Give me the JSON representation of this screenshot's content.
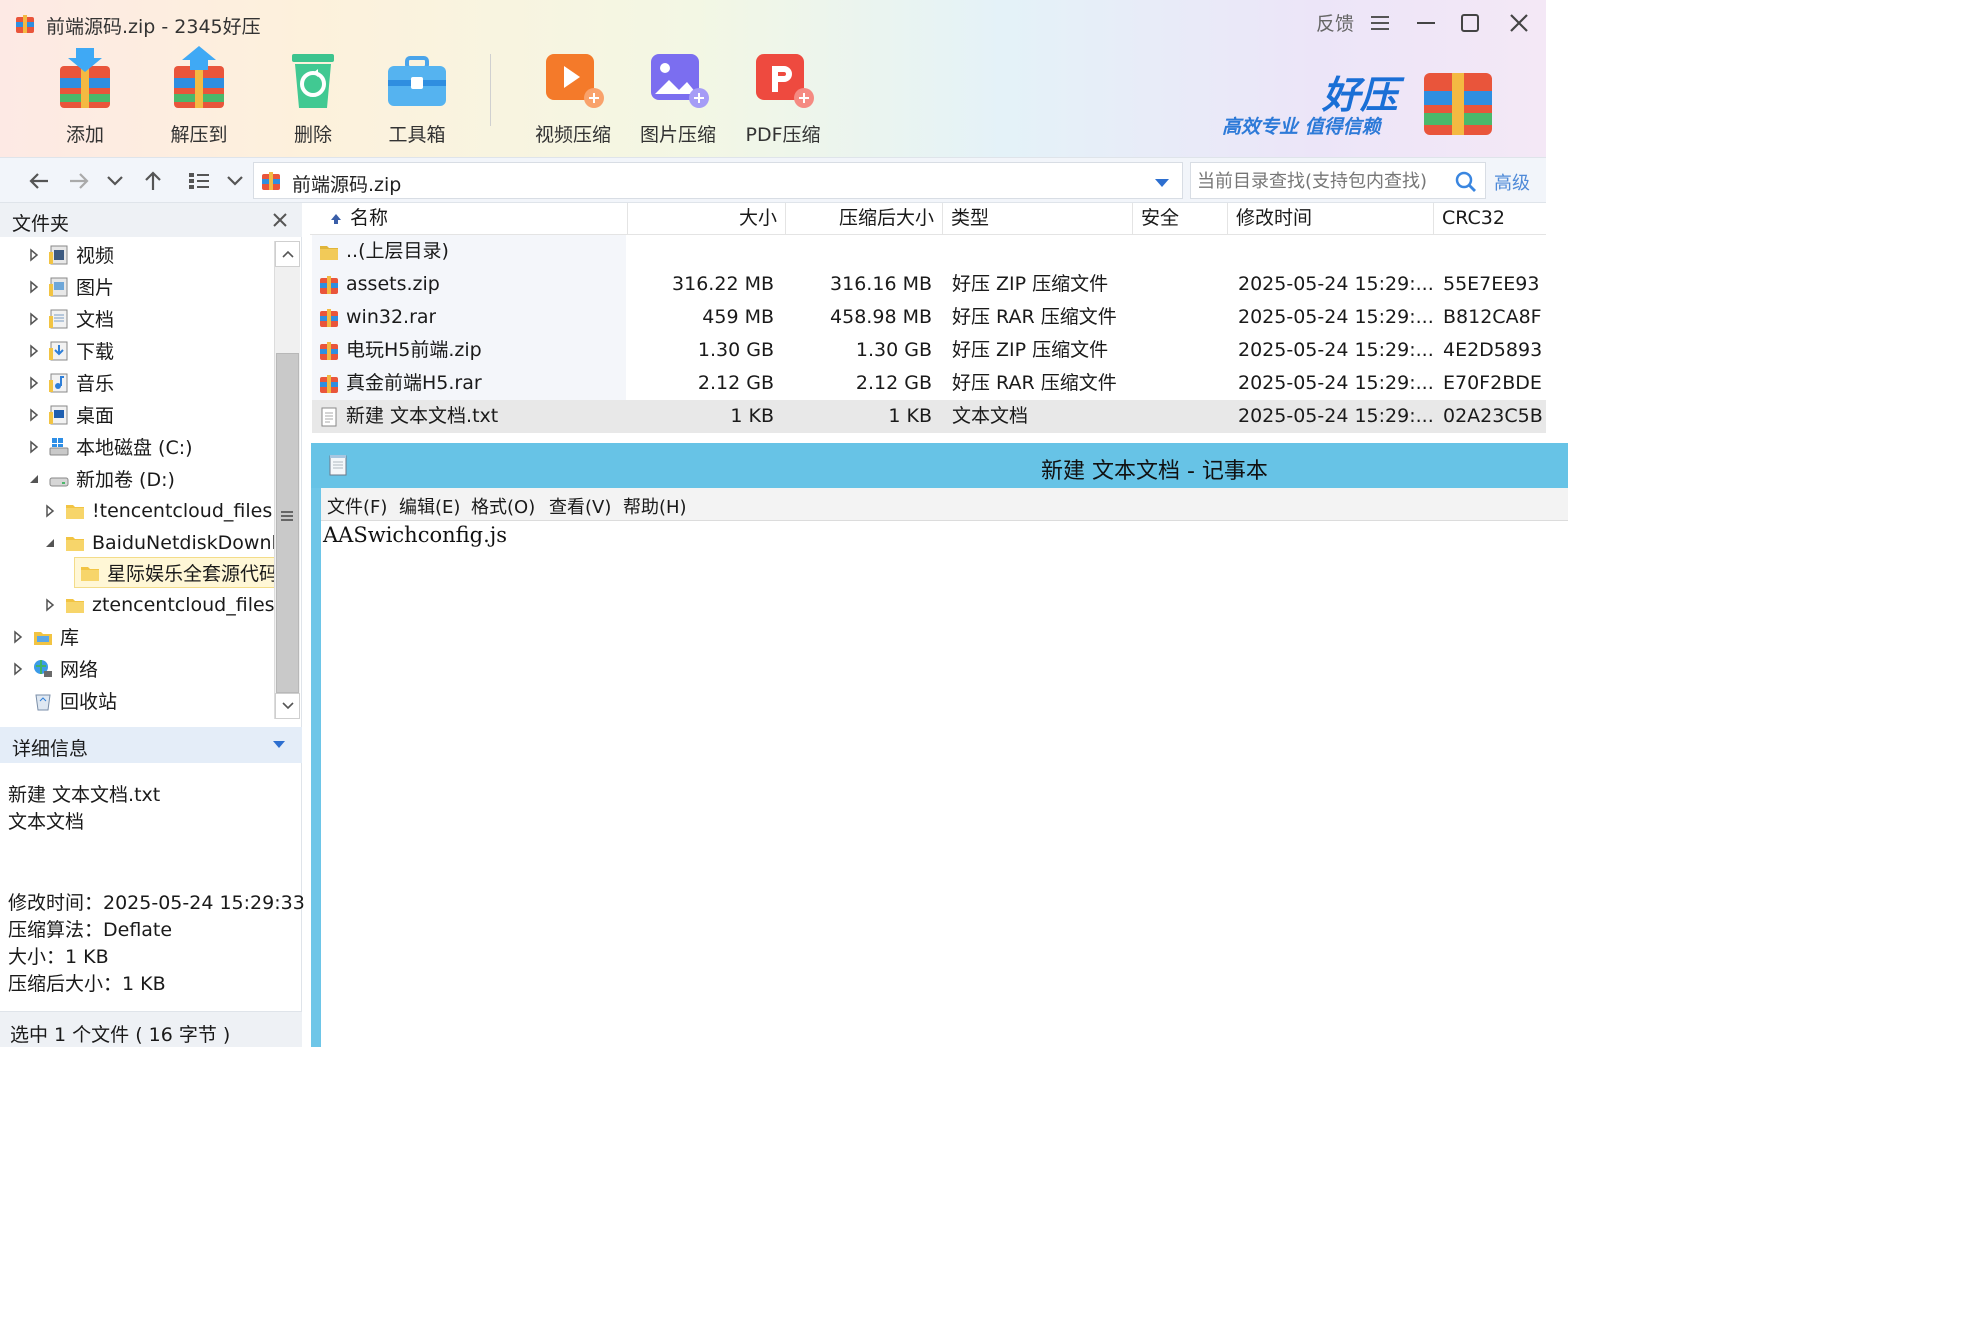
{
  "window": {
    "title": "前端源码.zip - 2345好压",
    "feedback": "反馈"
  },
  "toolbar": {
    "add": "添加",
    "extract": "解压到",
    "delete": "删除",
    "toolbox": "工具箱",
    "video": "视频压缩",
    "image": "图片压缩",
    "pdf": "PDF压缩"
  },
  "brand": {
    "name": "好压",
    "slogan": "高效专业 值得信赖"
  },
  "nav": {
    "address": "前端源码.zip",
    "search_placeholder": "当前目录查找(支持包内查找)",
    "advanced": "高级"
  },
  "sidebar": {
    "title": "文件夹",
    "tree": [
      {
        "label": "视频"
      },
      {
        "label": "图片"
      },
      {
        "label": "文档"
      },
      {
        "label": "下载"
      },
      {
        "label": "音乐"
      },
      {
        "label": "桌面"
      },
      {
        "label": "本地磁盘 (C:)"
      },
      {
        "label": "新加卷 (D:)"
      },
      {
        "label": "!tencentcloud_files"
      },
      {
        "label": "BaiduNetdiskDownload"
      },
      {
        "label": "星际娱乐全套源代码"
      },
      {
        "label": "ztencentcloud_files"
      },
      {
        "label": "库"
      },
      {
        "label": "网络"
      },
      {
        "label": "回收站"
      }
    ],
    "details_title": "详细信息",
    "details": {
      "filename": "新建 文本文档.txt",
      "filetype": "文本文档",
      "modified": "修改时间：2025-05-24 15:29:33",
      "method": "压缩算法：Deflate",
      "size": "大小：1 KB",
      "packed": "压缩后大小：1 KB"
    },
    "status": "选中 1 个文件 ( 16 字节 )"
  },
  "filelist": {
    "headers": {
      "name": "名称",
      "size": "大小",
      "packed": "压缩后大小",
      "type": "类型",
      "security": "安全",
      "modified": "修改时间",
      "crc": "CRC32"
    },
    "rows": [
      {
        "name": "..(上层目录)",
        "size": "",
        "packed": "",
        "type": "",
        "modified": "",
        "crc": ""
      },
      {
        "name": "assets.zip",
        "size": "316.22 MB",
        "packed": "316.16 MB",
        "type": "好压 ZIP 压缩文件",
        "modified": "2025-05-24 15:29:...",
        "crc": "55E7EE93"
      },
      {
        "name": "win32.rar",
        "size": "459 MB",
        "packed": "458.98 MB",
        "type": "好压 RAR 压缩文件",
        "modified": "2025-05-24 15:29:...",
        "crc": "B812CA8F"
      },
      {
        "name": "电玩H5前端.zip",
        "size": "1.30 GB",
        "packed": "1.30 GB",
        "type": "好压 ZIP 压缩文件",
        "modified": "2025-05-24 15:29:...",
        "crc": "4E2D5893"
      },
      {
        "name": "真金前端H5.rar",
        "size": "2.12 GB",
        "packed": "2.12 GB",
        "type": "好压 RAR 压缩文件",
        "modified": "2025-05-24 15:29:...",
        "crc": "E70F2BDE"
      },
      {
        "name": "新建 文本文档.txt",
        "size": "1 KB",
        "packed": "1 KB",
        "type": "文本文档",
        "modified": "2025-05-24 15:29:...",
        "crc": "02A23C5B"
      }
    ]
  },
  "notepad": {
    "title": "新建 文本文档 - 记事本",
    "menu": [
      "文件(F)",
      "编辑(E)",
      "格式(O)",
      "查看(V)",
      "帮助(H)"
    ],
    "content": "AASwichconfig.js"
  },
  "colors": {
    "accent_blue": "#1a6fd6",
    "notepad_title": "#67c3e6",
    "selection": "#e8e8e8"
  }
}
